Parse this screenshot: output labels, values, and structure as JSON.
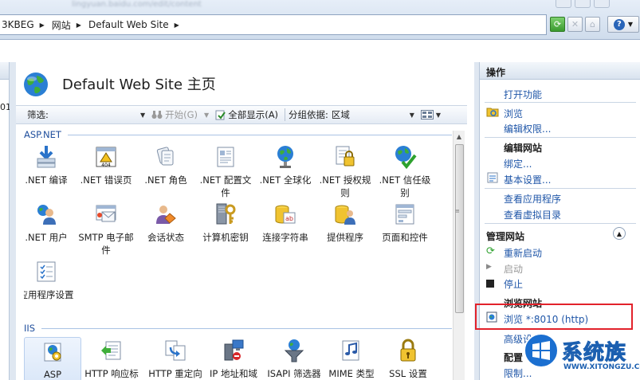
{
  "address_bar": {
    "blurred_url": "lingyuan.baidu.com/edit/content",
    "breadcrumbs": [
      "3KBEG",
      "网站",
      "Default Web Site"
    ]
  },
  "left_panel": {
    "clipped_text": "01"
  },
  "page": {
    "title": "Default Web Site 主页"
  },
  "filter_bar": {
    "filter_label": "筛选:",
    "filter_value": "",
    "start_label": "开始(G)",
    "show_all_label": "全部显示(A)",
    "group_label": "分组依据:",
    "group_value": "区域"
  },
  "categories": [
    {
      "name": "ASP.NET",
      "features": [
        {
          "label": ".NET 编译",
          "icon": "compile-icon"
        },
        {
          "label": ".NET 错误页",
          "icon": "error-page-icon"
        },
        {
          "label": ".NET 角色",
          "icon": "roles-icon"
        },
        {
          "label": ".NET 配置文件",
          "icon": "profile-icon"
        },
        {
          "label": ".NET 全球化",
          "icon": "globalization-icon"
        },
        {
          "label": ".NET 授权规则",
          "icon": "authorization-icon"
        },
        {
          "label": ".NET 信任级别",
          "icon": "trust-level-icon"
        },
        {
          "label": ".NET 用户",
          "icon": "users-icon"
        },
        {
          "label": "SMTP 电子邮件",
          "icon": "smtp-icon"
        },
        {
          "label": "会话状态",
          "icon": "session-icon"
        },
        {
          "label": "计算机密钥",
          "icon": "machine-key-icon"
        },
        {
          "label": "连接字符串",
          "icon": "connection-string-icon"
        },
        {
          "label": "提供程序",
          "icon": "providers-icon"
        },
        {
          "label": "页面和控件",
          "icon": "pages-controls-icon"
        },
        {
          "label": "应用程序设置",
          "icon": "app-settings-icon"
        }
      ]
    },
    {
      "name": "IIS",
      "features": [
        {
          "label": "ASP",
          "icon": "asp-icon"
        },
        {
          "label": "HTTP 响应标",
          "icon": "http-headers-icon"
        },
        {
          "label": "HTTP 重定向",
          "icon": "http-redirect-icon"
        },
        {
          "label": "IP 地址和域",
          "icon": "ip-domain-icon"
        },
        {
          "label": "ISAPI 筛选器",
          "icon": "isapi-icon"
        },
        {
          "label": "MIME 类型",
          "icon": "mime-icon"
        },
        {
          "label": "SSL 设置",
          "icon": "ssl-icon"
        }
      ]
    }
  ],
  "actions": {
    "header": "操作",
    "items": {
      "open_feature": "打开功能",
      "browse": "浏览",
      "edit_permissions": "编辑权限...",
      "edit_site_section": "编辑网站",
      "bindings": "绑定...",
      "basic_settings": "基本设置...",
      "view_apps": "查看应用程序",
      "view_vdirs": "查看虚拟目录",
      "manage_site_section": "管理网站",
      "restart": "重新启动",
      "start": "启动",
      "stop": "停止",
      "browse_site_section": "浏览网站",
      "browse_port": "浏览 *:8010 (http)",
      "advanced_settings": "高级设置...",
      "configure_section": "配置",
      "limits": "限制..."
    }
  },
  "watermark": {
    "name": "系统族",
    "url": "WWW.XITONGZU.COM"
  },
  "colors": {
    "link": "#1f56a8",
    "category": "#1f4e9c",
    "highlight": "#e2222b"
  }
}
